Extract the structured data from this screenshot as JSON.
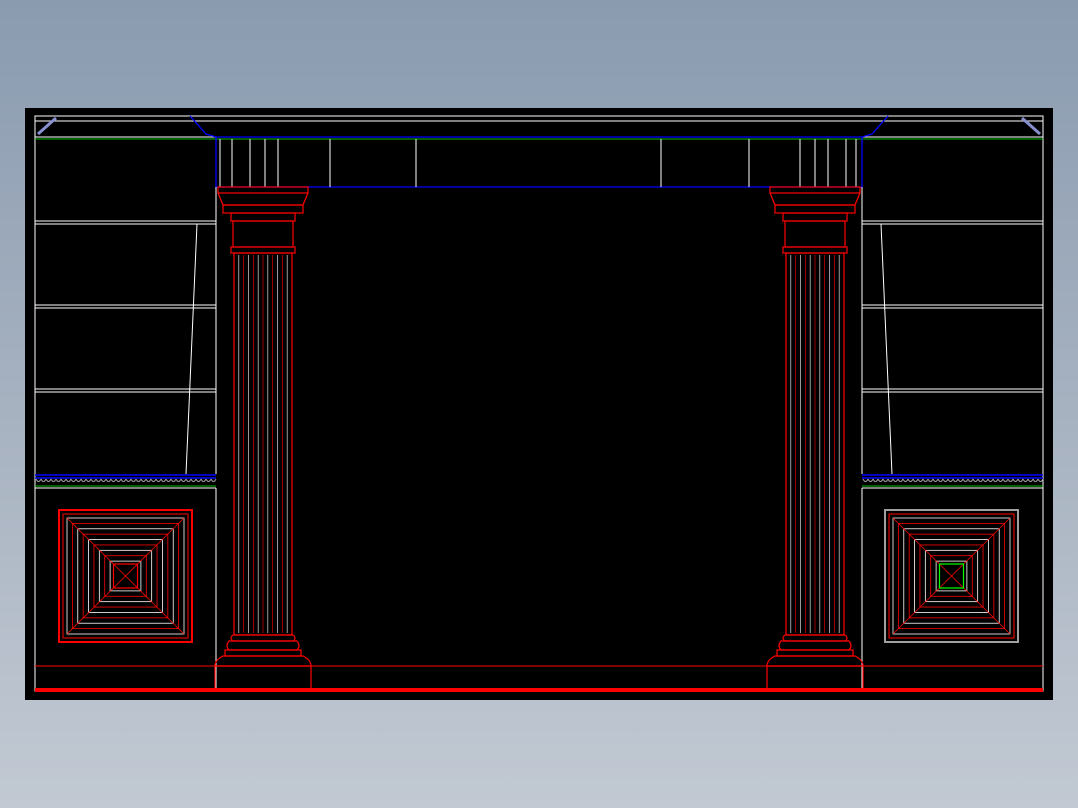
{
  "colors": {
    "background_top": "#8a9bb0",
    "background_bottom": "#c2c9d3",
    "viewport": "#000000",
    "white": "#ffffff",
    "red": "#ff0000",
    "blue": "#0000ff",
    "green": "#00c000",
    "gray": "#a0a0a0"
  },
  "drawing": {
    "subject": "classical-column-wall-elevation",
    "elements": [
      "entablature",
      "left-column",
      "right-column",
      "left-bookshelf",
      "right-bookshelf",
      "left-coffered-panel",
      "right-coffered-panel",
      "floor-line"
    ]
  }
}
